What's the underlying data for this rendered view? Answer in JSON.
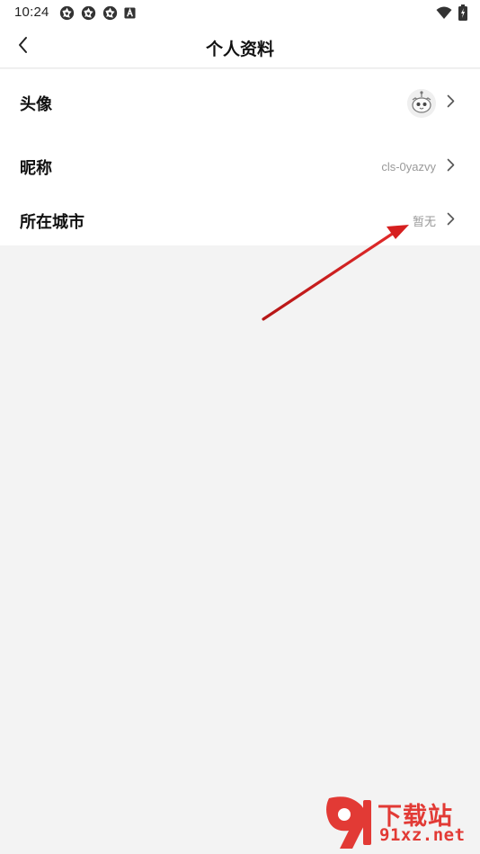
{
  "status_bar": {
    "time": "10:24",
    "left_icons": [
      "shutter-icon",
      "shutter-icon",
      "shutter-icon",
      "font-a-icon"
    ],
    "right_icons": [
      "wifi-icon",
      "battery-charging-icon"
    ]
  },
  "nav": {
    "title": "个人资料",
    "back_icon": "chevron-left-icon"
  },
  "rows": [
    {
      "label": "头像",
      "value": "",
      "kind": "avatar"
    },
    {
      "label": "昵称",
      "value": "cls-0yazvy",
      "kind": "text"
    },
    {
      "label": "所在城市",
      "value": "暂无",
      "kind": "text"
    }
  ],
  "watermark": {
    "logo_text": "9",
    "top_text": "下载站",
    "bottom_text": "91xz.net"
  },
  "colors": {
    "annotation_arrow": "#d61f1f",
    "watermark": "#e23a35",
    "page_background": "#f3f3f3"
  }
}
